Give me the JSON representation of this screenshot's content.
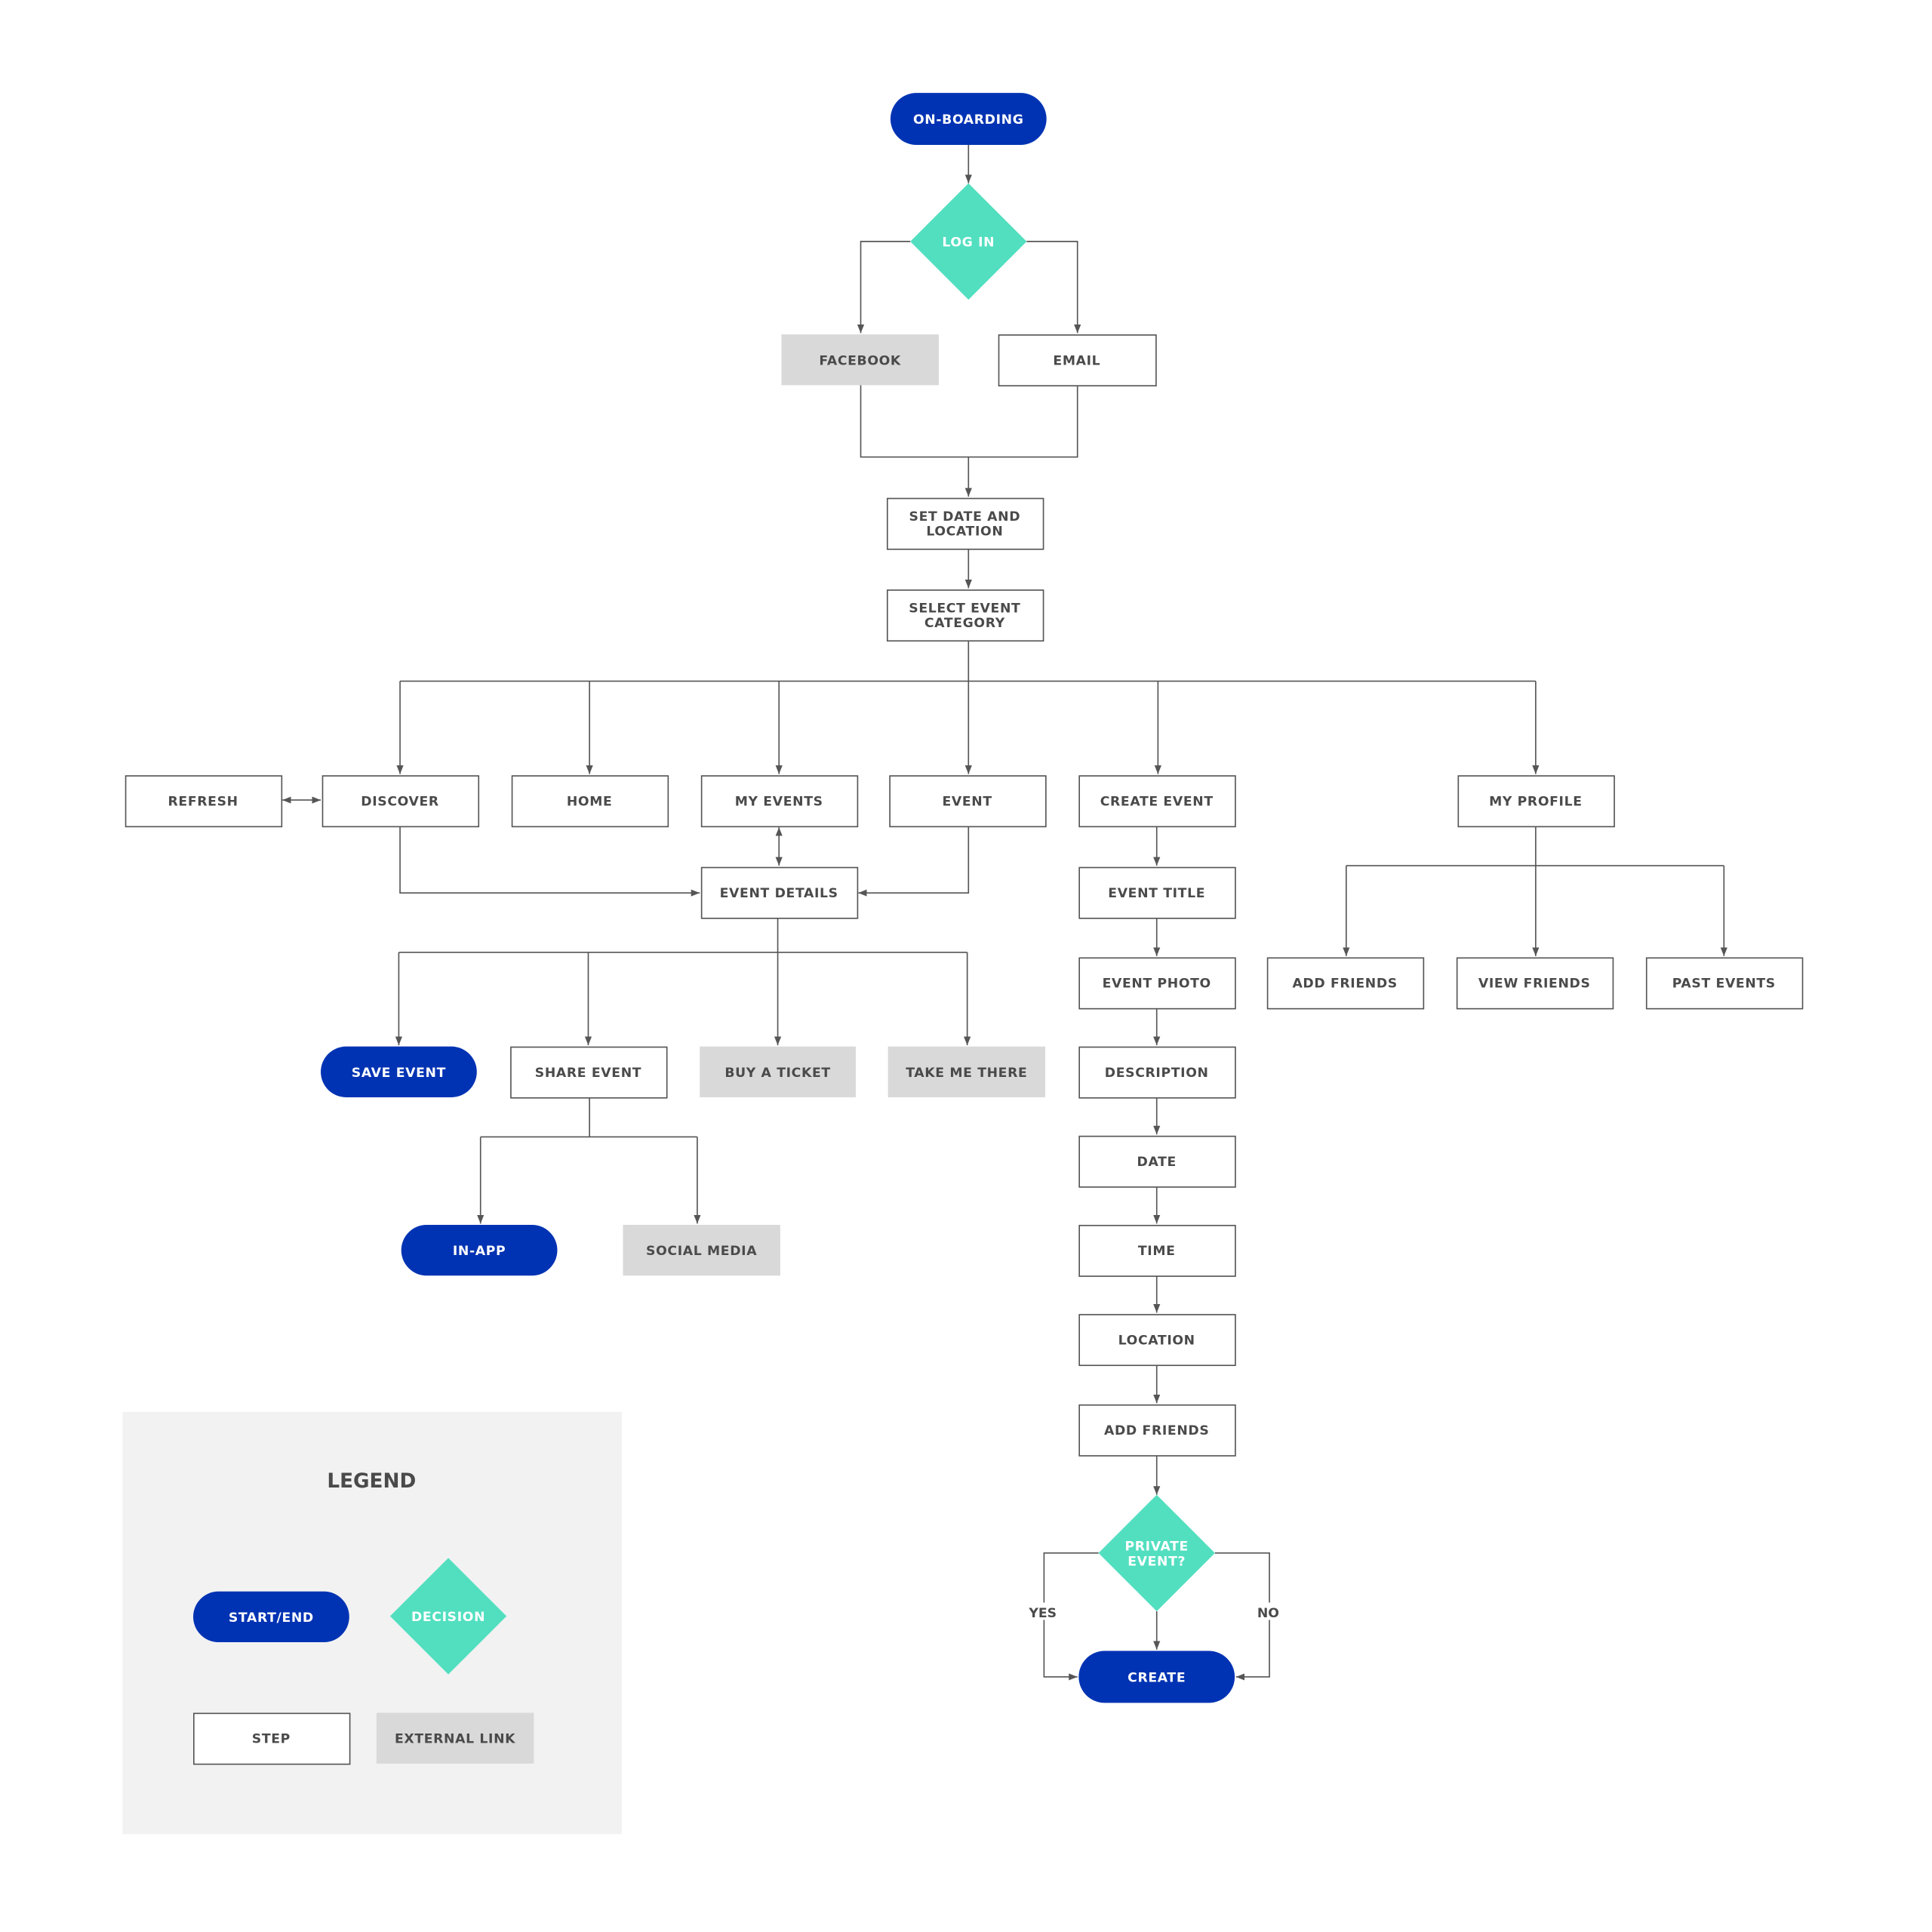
{
  "colors": {
    "start_end": "#0033b3",
    "decision": "#52dfc0",
    "external_link": "#d9d9d9",
    "step_border": "#555555",
    "text": "#4a4a4a",
    "line": "#555555",
    "legend_bg": "#f2f2f2"
  },
  "nodes": {
    "onboarding": {
      "type": "start_end",
      "label": [
        "ON-BOARDING"
      ]
    },
    "login": {
      "type": "decision",
      "label": [
        "LOG IN"
      ]
    },
    "facebook": {
      "type": "external_link",
      "label": [
        "FACEBOOK"
      ]
    },
    "email": {
      "type": "step",
      "label": [
        "EMAIL"
      ]
    },
    "set_date": {
      "type": "step",
      "label": [
        "SET DATE AND",
        "LOCATION"
      ]
    },
    "select_category": {
      "type": "step",
      "label": [
        "SELECT EVENT",
        "CATEGORY"
      ]
    },
    "refresh": {
      "type": "step",
      "label": [
        "REFRESH"
      ]
    },
    "discover": {
      "type": "step",
      "label": [
        "DISCOVER"
      ]
    },
    "home": {
      "type": "step",
      "label": [
        "HOME"
      ]
    },
    "my_events": {
      "type": "step",
      "label": [
        "MY EVENTS"
      ]
    },
    "event": {
      "type": "step",
      "label": [
        "EVENT"
      ]
    },
    "create_event": {
      "type": "step",
      "label": [
        "CREATE EVENT"
      ]
    },
    "my_profile": {
      "type": "step",
      "label": [
        "MY PROFILE"
      ]
    },
    "event_details": {
      "type": "step",
      "label": [
        "EVENT DETAILS"
      ]
    },
    "event_title": {
      "type": "step",
      "label": [
        "EVENT TITLE"
      ]
    },
    "event_photo": {
      "type": "step",
      "label": [
        "EVENT PHOTO"
      ]
    },
    "add_friends_profile": {
      "type": "step",
      "label": [
        "ADD FRIENDS"
      ]
    },
    "view_friends": {
      "type": "step",
      "label": [
        "VIEW FRIENDS"
      ]
    },
    "past_events": {
      "type": "step",
      "label": [
        "PAST EVENTS"
      ]
    },
    "save_event": {
      "type": "start_end",
      "label": [
        "SAVE EVENT"
      ]
    },
    "share_event": {
      "type": "step",
      "label": [
        "SHARE EVENT"
      ]
    },
    "buy_ticket": {
      "type": "external_link",
      "label": [
        "BUY A TICKET"
      ]
    },
    "take_me_there": {
      "type": "external_link",
      "label": [
        "TAKE ME THERE"
      ]
    },
    "description": {
      "type": "step",
      "label": [
        "DESCRIPTION"
      ]
    },
    "date": {
      "type": "step",
      "label": [
        "DATE"
      ]
    },
    "time": {
      "type": "step",
      "label": [
        "TIME"
      ]
    },
    "location": {
      "type": "step",
      "label": [
        "LOCATION"
      ]
    },
    "add_friends_create": {
      "type": "step",
      "label": [
        "ADD FRIENDS"
      ]
    },
    "in_app": {
      "type": "start_end",
      "label": [
        "IN-APP"
      ]
    },
    "social_media": {
      "type": "external_link",
      "label": [
        "SOCIAL MEDIA"
      ]
    },
    "private_event": {
      "type": "decision",
      "label": [
        "PRIVATE",
        "EVENT?"
      ]
    },
    "create": {
      "type": "start_end",
      "label": [
        "CREATE"
      ]
    }
  },
  "edge_labels": {
    "yes": "YES",
    "no": "NO"
  },
  "legend": {
    "title": "LEGEND",
    "items": {
      "start_end": "START/END",
      "decision": "DECISION",
      "step": "STEP",
      "external_link": "EXTERNAL LINK"
    }
  }
}
